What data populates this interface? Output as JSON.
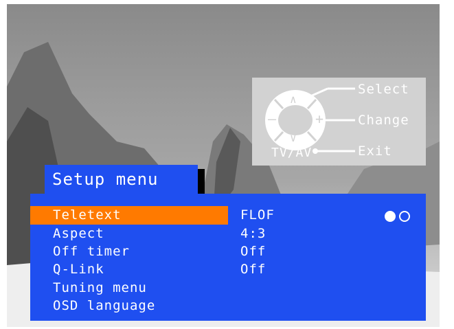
{
  "colors": {
    "menu_blue": "#1f4ff0",
    "selected_orange": "#ff7a00",
    "remote_panel": "#d2d2d2",
    "text": "#ffffff"
  },
  "remote_hints": {
    "select_label": "Select",
    "change_label": "Change",
    "exit_label": "Exit",
    "tvav_label": "TV/AV",
    "icon_up": "up-arrow-icon",
    "icon_down": "down-arrow-icon",
    "icon_left": "minus-icon",
    "icon_right": "plus-icon"
  },
  "menu": {
    "title": "Setup menu",
    "items": [
      {
        "label": "Teletext",
        "value": "FLOF",
        "selected": true
      },
      {
        "label": "Aspect",
        "value": "4:3",
        "selected": false
      },
      {
        "label": "Off timer",
        "value": "Off",
        "selected": false
      },
      {
        "label": "Q-Link",
        "value": "Off",
        "selected": false
      },
      {
        "label": "Tuning menu",
        "value": "",
        "selected": false
      },
      {
        "label": "OSD language",
        "value": "",
        "selected": false
      }
    ],
    "pages": {
      "current": 1,
      "total": 2
    }
  }
}
